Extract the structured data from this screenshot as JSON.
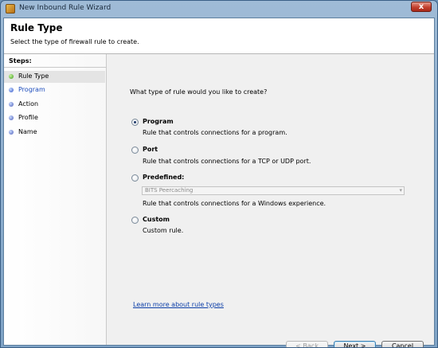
{
  "window": {
    "title": "New Inbound Rule Wizard",
    "close_glyph": "x"
  },
  "header": {
    "title": "Rule Type",
    "subtitle": "Select the type of firewall rule to create."
  },
  "steps": {
    "label": "Steps:",
    "items": [
      {
        "label": "Rule Type",
        "state": "done"
      },
      {
        "label": "Program",
        "state": "current"
      },
      {
        "label": "Action",
        "state": "pending"
      },
      {
        "label": "Profile",
        "state": "pending"
      },
      {
        "label": "Name",
        "state": "pending"
      }
    ]
  },
  "main": {
    "question": "What type of rule would you like to create?",
    "options": [
      {
        "title": "Program",
        "description": "Rule that controls connections for a program.",
        "selected": true
      },
      {
        "title": "Port",
        "description": "Rule that controls connections for a TCP or UDP port.",
        "selected": false
      },
      {
        "title": "Predefined:",
        "description": "Rule that controls connections for a Windows experience.",
        "selected": false
      },
      {
        "title": "Custom",
        "description": "Custom rule.",
        "selected": false
      }
    ],
    "predefined_select": {
      "value": "BITS Peercaching",
      "enabled": false
    },
    "learn_more": "Learn more about rule types"
  },
  "buttons": {
    "back": "< Back",
    "next": "Next >",
    "cancel": "Cancel"
  },
  "colors": {
    "link": "#0b3ea8",
    "current_step": "#1d4dbd"
  }
}
